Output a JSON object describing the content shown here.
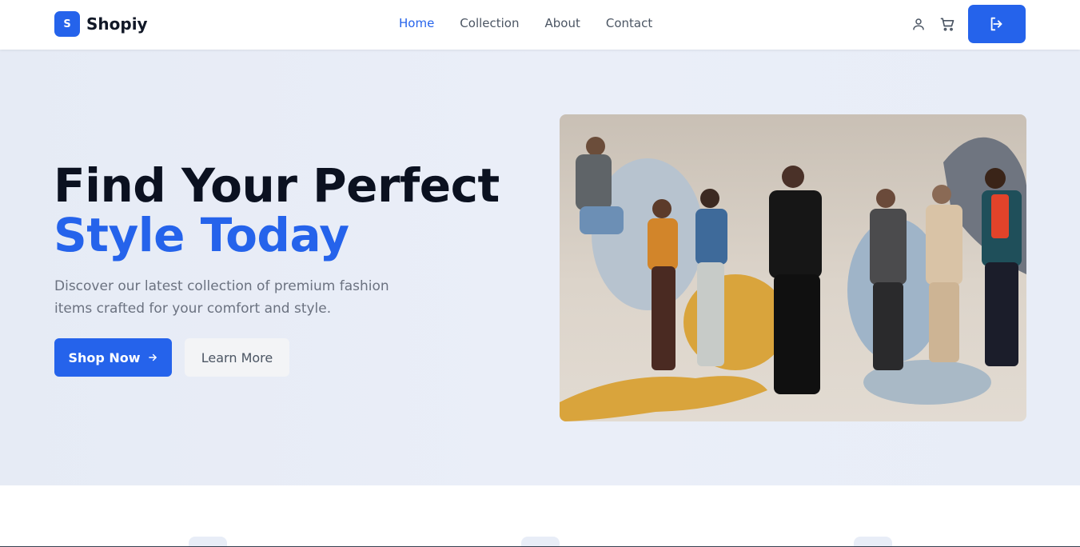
{
  "brand": {
    "badge": "S",
    "name": "Shopiy",
    "color": "#2563eb"
  },
  "nav": {
    "items": [
      {
        "label": "Home",
        "active": true
      },
      {
        "label": "Collection",
        "active": false
      },
      {
        "label": "About",
        "active": false
      },
      {
        "label": "Contact",
        "active": false
      }
    ]
  },
  "header_actions": {
    "user_icon": "user-icon",
    "cart_icon": "cart-icon",
    "logout_icon": "logout-icon"
  },
  "hero": {
    "title_line1": "Find Your Perfect",
    "title_line2": "Style Today",
    "description": "Discover our latest collection of premium fashion items crafted for your comfort and style.",
    "primary_button": "Shop Now",
    "secondary_button": "Learn More"
  },
  "colors": {
    "accent": "#2563eb",
    "hero_bg": "#e8edf7",
    "heading": "#0b1120",
    "muted": "#6b7280"
  }
}
